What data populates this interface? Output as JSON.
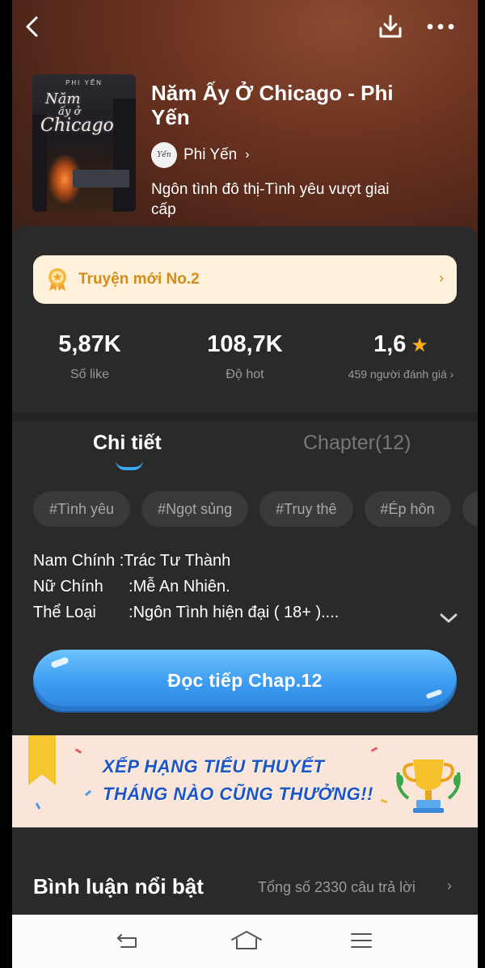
{
  "book": {
    "title": "Năm Ấy Ở Chicago - Phi Yến",
    "cover_author": "PHI YẾN",
    "author": "Phi Yến",
    "genre": "Ngôn tình đô thị-Tình yêu vượt giai cấp"
  },
  "header": {
    "back_icon": "back-arrow-icon",
    "download_icon": "download-icon",
    "more_icon": "more-dots-icon"
  },
  "rank": {
    "label": "Truyện mới No.2",
    "icon": "medal-icon"
  },
  "stats": [
    {
      "value": "5,87K",
      "label": "Số like"
    },
    {
      "value": "108,7K",
      "label": "Độ hot"
    },
    {
      "value": "1,6",
      "label": "459 người đánh giá ›"
    }
  ],
  "tabs": {
    "detail": "Chi tiết",
    "chapter": "Chapter(12)"
  },
  "tags": [
    "#Tình yêu",
    "#Ngọt sủng",
    "#Truy thê",
    "#Ép hôn"
  ],
  "info": [
    {
      "key": "Nam Chính",
      "sep": ": ",
      "value": "Trác Tư Thành"
    },
    {
      "key": "Nữ Chính",
      "sep": ": ",
      "value": "Mễ An Nhiên."
    },
    {
      "key": "Thể Loại",
      "sep": ": ",
      "value": "Ngôn Tình hiện đại ( 18+ )...."
    }
  ],
  "read_button": {
    "label": "Đọc tiếp Chap.12"
  },
  "banner": {
    "line1": "XẾP HẠNG TIỂU THUYẾT",
    "line2": "THÁNG NÀO CŨNG THƯỞNG!!"
  },
  "comments": {
    "title": "Bình luận nổi bật",
    "total": "Tổng số 2330 câu trả lời"
  },
  "colors": {
    "accent_blue": "#3b9bf0",
    "rank_orange": "#d58a1a",
    "star": "#f5b21a",
    "background": "#2a2a2b"
  }
}
